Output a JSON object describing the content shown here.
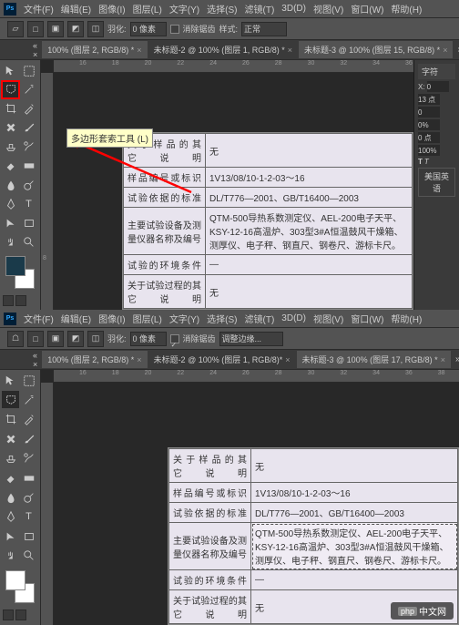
{
  "app": {
    "logo": "Ps"
  },
  "menu": [
    "文件(F)",
    "编辑(E)",
    "图像(I)",
    "图层(L)",
    "文字(Y)",
    "选择(S)",
    "滤镜(T)",
    "3D(D)",
    "视图(V)",
    "窗口(W)",
    "帮助(H)"
  ],
  "options_top": {
    "feather_label": "羽化:",
    "feather_value": "0 像素",
    "antialias_label": "消除锯齿",
    "style_label": "样式:",
    "style_value": "正常"
  },
  "options_bottom": {
    "feather_label": "羽化:",
    "feather_value": "0 像素",
    "antialias_label": "消除锯齿",
    "refine_label": "调整边缘..."
  },
  "tabs_top": [
    {
      "label": "100% (图层 2, RGB/8) *"
    },
    {
      "label": "未标题-2 @ 100% (图层 1, RGB/8) *"
    },
    {
      "label": "未标题-3 @ 100% (图层 15, RGB/8) *"
    }
  ],
  "tabs_bottom": [
    {
      "label": "100% (图层 2, RGB/8) *"
    },
    {
      "label": "未标题-2 @ 100% (图层 1, RGB/8)*"
    },
    {
      "label": "未标题-3 @ 100% (图层 17, RGB/8) *"
    }
  ],
  "tooltip": "多边形套索工具 (L)",
  "right_panel": {
    "tab_label": "字符",
    "percent": "0%",
    "indent": "0 点",
    "text_btn1": "T",
    "text_btn2": "T",
    "lang_btn": "美国英语",
    "val_x": "X:",
    "val_0": "0",
    "val_100": "100%",
    "val_13": "13 点"
  },
  "document": {
    "rows": [
      {
        "label": "关 于 样 品 的\n其 它 说 明",
        "value": "无"
      },
      {
        "label": "样品编号或标识",
        "value": "1V13/08/10-1-2-03～16"
      },
      {
        "label": "试验依据的标准",
        "value": "DL/T776—2001、GB/T16400—2003"
      },
      {
        "label": "主要试验设备及测量仪器名称及编号",
        "value": "QTM-500导热系数测定仪、AEL-200电子天平、KSY-12-16高温炉、303型3#A恒温鼓风干燥箱、测厚仪、电子秤、钢直尺、钢卷尺、游标卡尺。"
      },
      {
        "label": "试验的环境条件",
        "value": "—"
      },
      {
        "label": "关于试验过程的其\n它\t说\t明",
        "value": "无"
      }
    ]
  },
  "watermark": {
    "logo": "php",
    "text": "中文网"
  }
}
